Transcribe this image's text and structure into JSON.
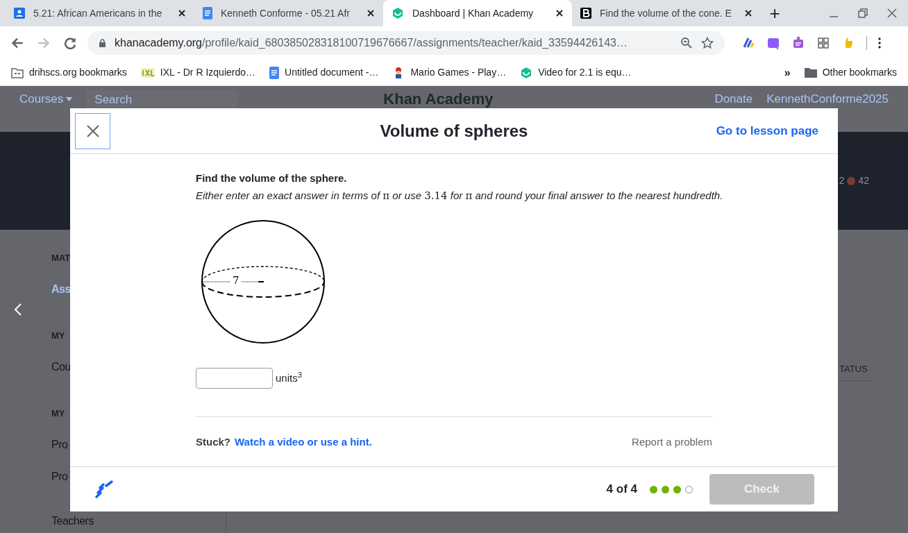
{
  "browser": {
    "tabs": [
      {
        "title": "5.21: African Americans in the",
        "kind": "classroom",
        "selected": false
      },
      {
        "title": "Kenneth Conforme - 05.21 Afr",
        "kind": "docs",
        "selected": false
      },
      {
        "title": "Dashboard | Khan Academy",
        "kind": "khan",
        "selected": true
      },
      {
        "title": "Find the volume of the cone. E",
        "kind": "brainly",
        "selected": false
      }
    ],
    "new_tab": "+",
    "address": {
      "domain": "khanacademy.org",
      "path": "/profile/kaid_680385028318100719676667/assignments/teacher/kaid_33594426143…"
    },
    "bookmarks": [
      {
        "label": "drihscs.org bookmarks",
        "kind": "folder"
      },
      {
        "label": "IXL - Dr R Izquierdo…",
        "kind": "ixl"
      },
      {
        "label": "Untitled document -…",
        "kind": "docs"
      },
      {
        "label": "Mario Games - Play…",
        "kind": "mario"
      },
      {
        "label": "Video for 2.1 is equ…",
        "kind": "khan"
      }
    ],
    "overflow": "»",
    "other_bookmarks": "Other bookmarks"
  },
  "background_page": {
    "nav": {
      "courses": "Courses",
      "search_placeholder": "Search",
      "logo": "Khan Academy",
      "donate": "Donate",
      "username": "KennethConforme2025"
    },
    "stats": [
      "2",
      "42"
    ],
    "sidebar": [
      {
        "text": "MAT",
        "kind": "heading"
      },
      {
        "text": "Ass",
        "kind": "active"
      },
      {
        "text": "MY",
        "kind": "heading"
      },
      {
        "text": "Cou",
        "kind": "link"
      },
      {
        "text": "MY",
        "kind": "heading"
      },
      {
        "text": "Pro",
        "kind": "link"
      },
      {
        "text": "Pro",
        "kind": "link"
      },
      {
        "text": "Teachers",
        "kind": "link"
      }
    ],
    "table_header": "TATUS"
  },
  "modal": {
    "title": "Volume of spheres",
    "lesson_link": "Go to lesson page",
    "question": {
      "prompt": "Find the volume of the sphere.",
      "instructions": [
        {
          "kind": "text",
          "text": "Either enter an exact answer in terms of "
        },
        {
          "kind": "math",
          "text": "π"
        },
        {
          "kind": "text",
          "text": " or use "
        },
        {
          "kind": "math",
          "text": "3.14"
        },
        {
          "kind": "text",
          "text": " for "
        },
        {
          "kind": "math",
          "text": "π"
        },
        {
          "kind": "text",
          "text": " and round your final answer to the nearest hundredth."
        }
      ],
      "radius_label": "7",
      "unit": "units$^{3}$"
    },
    "stuck": "Stuck?",
    "hint_link": "Watch a video or use a hint.",
    "report": "Report a problem",
    "progress": "4 of 4",
    "dots": [
      {
        "done": true
      },
      {
        "done": true
      },
      {
        "done": true
      },
      {
        "done": false
      }
    ],
    "check_button": {
      "label": "Check",
      "disabled": true
    }
  }
}
